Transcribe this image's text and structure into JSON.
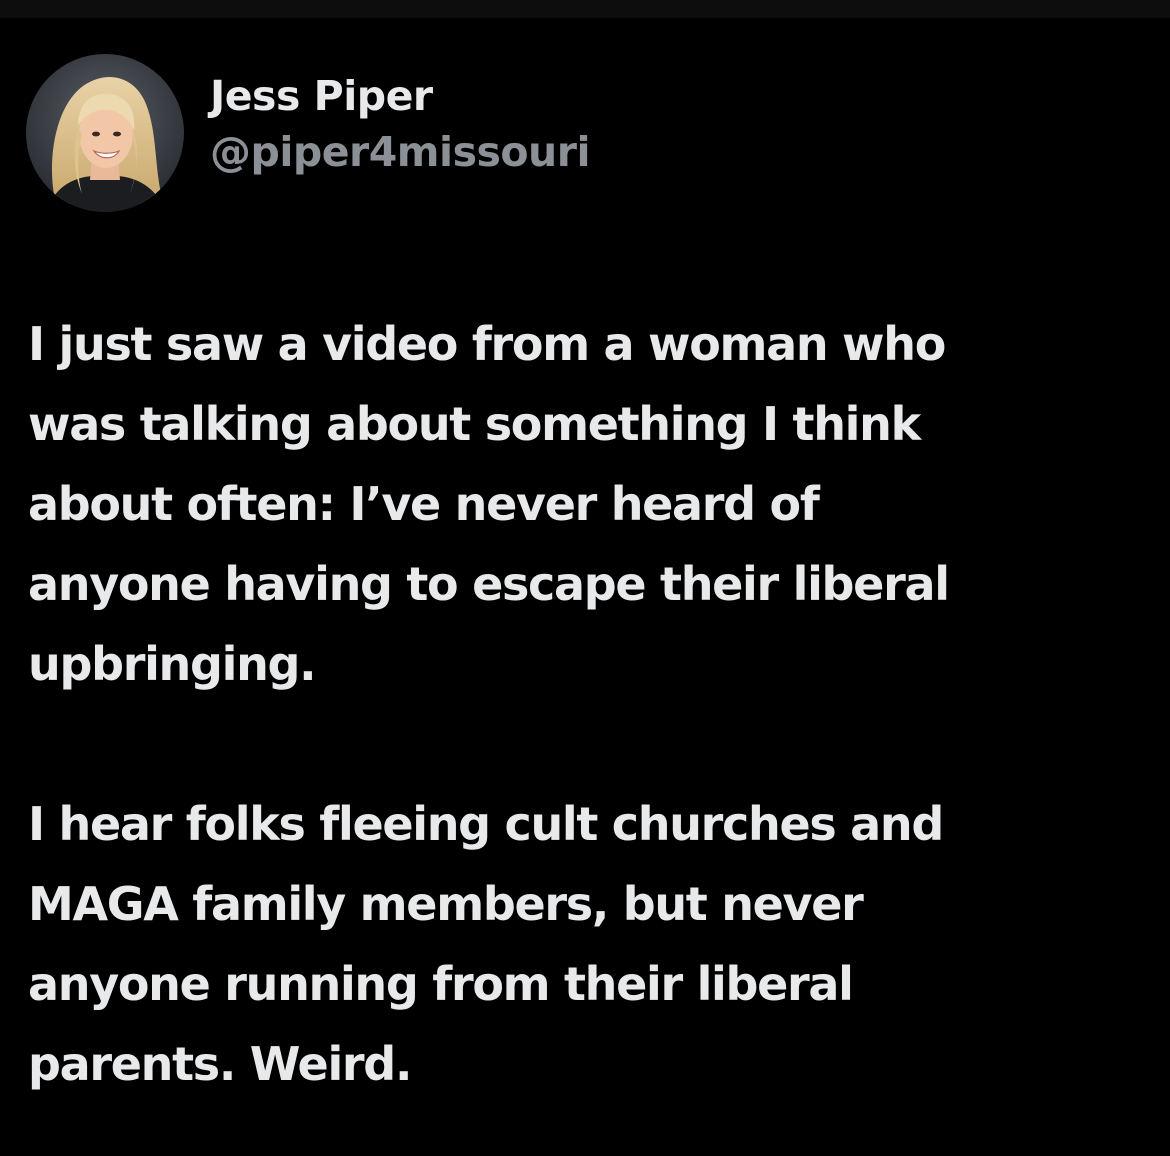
{
  "author": {
    "display_name": "Jess Piper",
    "handle": "@piper4missouri",
    "avatar": "profile-photo"
  },
  "post": {
    "paragraphs": [
      "I just saw a video from a woman who\nwas talking about something I think\nabout often: I’ve never heard of\nanyone having to escape their liberal\nupbringing.",
      "I hear folks fleeing cult churches and\nMAGA family members, but never\nanyone running from their liberal\nparents. Weird."
    ]
  },
  "colors": {
    "background": "#000000",
    "text_primary": "#e7e9ea",
    "text_secondary": "#8b9096"
  }
}
